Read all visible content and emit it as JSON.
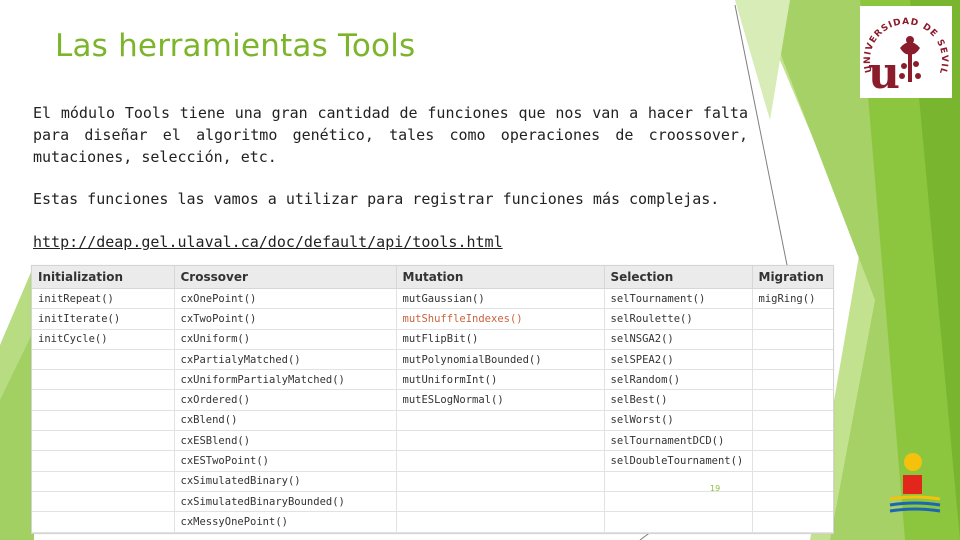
{
  "slide": {
    "title": "Las herramientas Tools",
    "paragraph1": "El módulo Tools tiene una gran cantidad de funciones que nos van a hacer falta para diseñar el algoritmo genético, tales como operaciones de croossover, mutaciones, selección, etc.",
    "paragraph2": "Estas funciones las vamos a utilizar para registrar funciones más complejas.",
    "link": "http://deap.gel.ulaval.ca/doc/default/api/tools.html",
    "page_number": "19"
  },
  "logo": {
    "brand_color": "#8b1c2c",
    "arc_text": "UNIVERSIDAD DE SEVILLA",
    "monogram": "u"
  },
  "colors": {
    "title": "#7cb52b",
    "accent_green": "#8cc63f",
    "highlight_text": "#c8643c"
  },
  "table": {
    "headers": [
      "Initialization",
      "Crossover",
      "Mutation",
      "Selection",
      "Migration"
    ],
    "rows": [
      [
        "initRepeat()",
        "cxOnePoint()",
        "mutGaussian()",
        "selTournament()",
        "migRing()"
      ],
      [
        "initIterate()",
        "cxTwoPoint()",
        "mutShuffleIndexes()",
        "selRoulette()",
        ""
      ],
      [
        "initCycle()",
        "cxUniform()",
        "mutFlipBit()",
        "selNSGA2()",
        ""
      ],
      [
        "",
        "cxPartialyMatched()",
        "mutPolynomialBounded()",
        "selSPEA2()",
        ""
      ],
      [
        "",
        "cxUniformPartialyMatched()",
        "mutUniformInt()",
        "selRandom()",
        ""
      ],
      [
        "",
        "cxOrdered()",
        "mutESLogNormal()",
        "selBest()",
        ""
      ],
      [
        "",
        "cxBlend()",
        "",
        "selWorst()",
        ""
      ],
      [
        "",
        "cxESBlend()",
        "",
        "selTournamentDCD()",
        ""
      ],
      [
        "",
        "cxESTwoPoint()",
        "",
        "selDoubleTournament()",
        ""
      ],
      [
        "",
        "cxSimulatedBinary()",
        "",
        "",
        ""
      ],
      [
        "",
        "cxSimulatedBinaryBounded()",
        "",
        "",
        ""
      ],
      [
        "",
        "cxMessyOnePoint()",
        "",
        "",
        ""
      ]
    ],
    "highlighted_cell": "mutShuffleIndexes()"
  }
}
